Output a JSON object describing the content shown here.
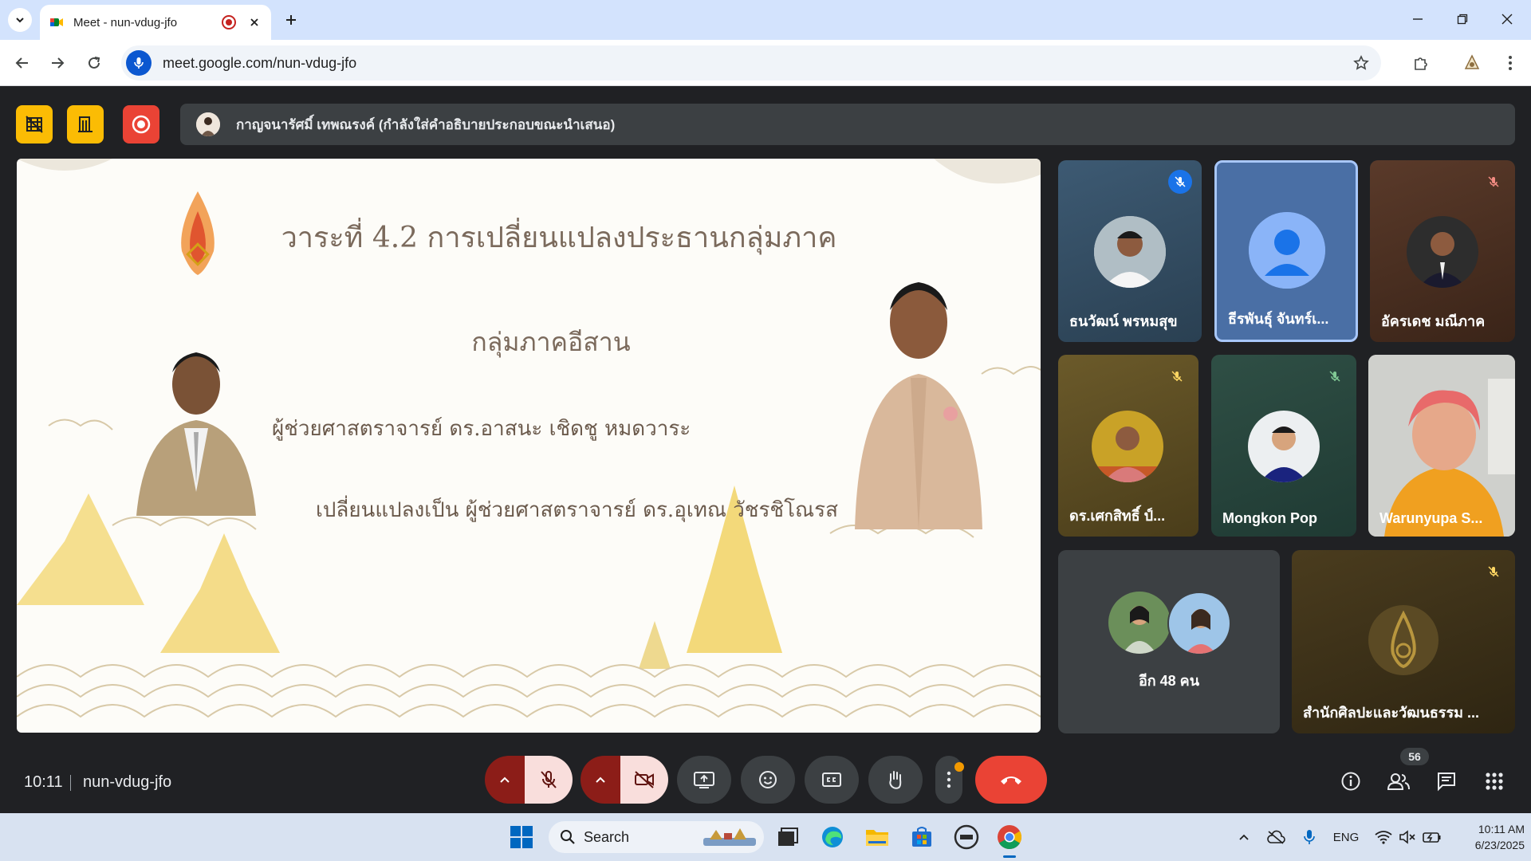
{
  "browser": {
    "tab_title": "Meet - nun-vdug-jfo",
    "url": "meet.google.com/nun-vdug-jfo"
  },
  "meet": {
    "presenting_text": "กาญจนารัศมิ์ เทพณรงค์ (กำลังใส่คำอธิบายประกอบขณะนำเสนอ)",
    "slide": {
      "title": "วาระที่ 4.2 การเปลี่ยนแปลงประธานกลุ่มภาค",
      "group": "กลุ่มภาคอีสาน",
      "old_chair": "ผู้ช่วยศาสตราจารย์ ดร.อาสนะ เชิดชู หมดวาระ",
      "new_chair": "เปลี่ยนแปลงเป็น  ผู้ช่วยศาสตราจารย์ ดร.อุเทณ วัชรชิโณรส"
    },
    "participants": [
      {
        "name": "ธนวัฒน์ พรหมสุข",
        "muted": true
      },
      {
        "name": "ธีรพันธุ์ จันทร์เ...",
        "muted": false
      },
      {
        "name": "อัครเดช มณีภาค",
        "muted": true
      },
      {
        "name": "ดร.เศกสิทธิ์ ป์...",
        "muted": true
      },
      {
        "name": "Mongkon Pop",
        "muted": true
      },
      {
        "name": "Warunyupa S...",
        "muted": false
      },
      {
        "name": "อีก 48 คน",
        "muted": false
      },
      {
        "name": "สำนักศิลปะและวัฒนธรรม ...",
        "muted": true
      }
    ],
    "time": "10:11",
    "meeting_code": "nun-vdug-jfo",
    "participant_count": "56",
    "colors": {
      "host_button": "#fbbc04",
      "record_button": "#ea4335",
      "end_call": "#ea4335",
      "mute_active_bg": "#f9dedc",
      "caret_bg": "#8c1d18"
    }
  },
  "taskbar": {
    "search_label": "Search",
    "language": "ENG",
    "clock_time": "10:11 AM",
    "clock_date": "6/23/2025"
  }
}
